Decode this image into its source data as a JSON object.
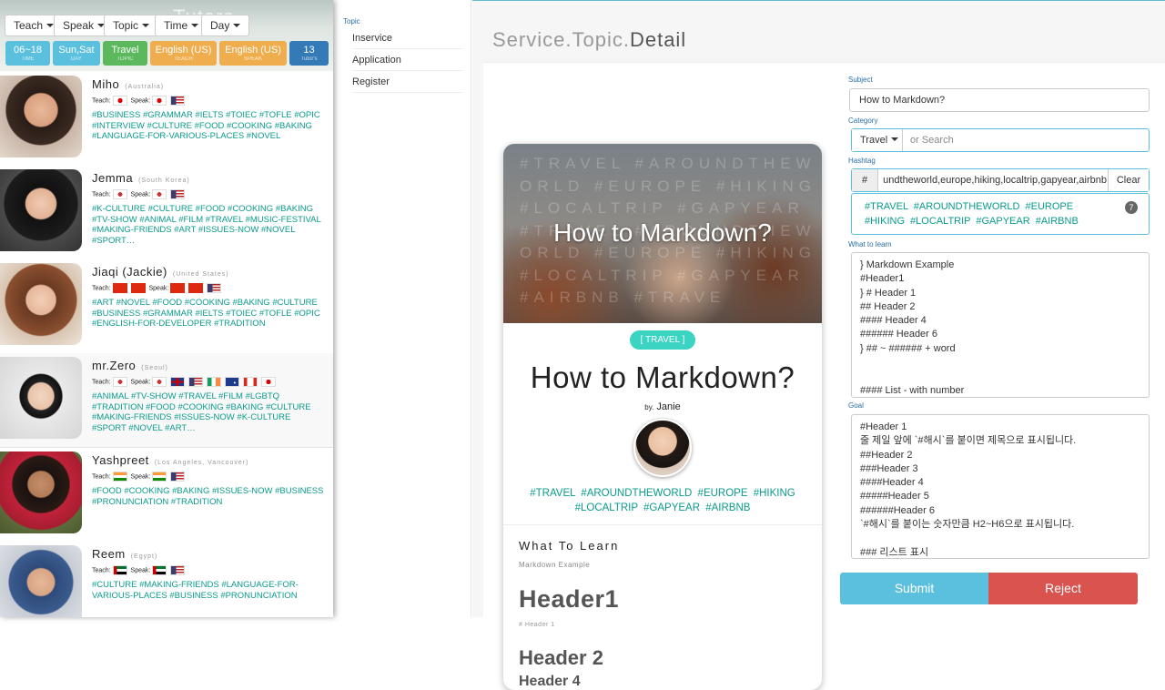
{
  "left": {
    "bg_title": "Tutors",
    "filters": [
      "Teach",
      "Speak",
      "Topic",
      "Time",
      "Day"
    ],
    "tags": [
      {
        "value": "06~18",
        "label": "TIME",
        "color": "#5bc0de"
      },
      {
        "value": "Sun,Sat",
        "label": "DAY",
        "color": "#5bc0de"
      },
      {
        "value": "Travel",
        "label": "TOPIC",
        "color": "#5cb85c"
      },
      {
        "value": "English (US)",
        "label": "TEACH",
        "color": "#f0ad4e"
      },
      {
        "value": "English (US)",
        "label": "SPEAK",
        "color": "#f0ad4e"
      },
      {
        "value": "13",
        "label": "Tutor's",
        "color": "#337ab7"
      }
    ],
    "teach_label": "Teach:",
    "speak_label": "Speak:",
    "tutors": [
      {
        "name": "Miho",
        "location": "(Australia)",
        "tags": "#BUSINESS #GRAMMAR #IELTS #TOIEC #TOFLE #OPIC #INTERVIEW #CULTURE #FOOD #COOKING #BAKING #LANGUAGE-FOR-VARIOUS-PLACES #NOVEL"
      },
      {
        "name": "Jemma",
        "location": "(South Korea)",
        "tags": "#K-CULTURE #CULTURE #FOOD #COOKING #BAKING #TV-SHOW #ANIMAL #FILM #TRAVEL #MUSIC-FESTIVAL #MAKING-FRIENDS #ART #ISSUES-NOW #NOVEL #SPORT…"
      },
      {
        "name": "Jiaqi (Jackie)",
        "location": "(United States)",
        "tags": "#ART #NOVEL #FOOD #COOKING #BAKING #CULTURE #BUSINESS #GRAMMAR #IELTS #TOIEC #TOFLE #OPIC #ENGLISH-FOR-DEVELOPER #TRADITION"
      },
      {
        "name": "mr.Zero",
        "location": "(Seoul)",
        "tags": "#ANIMAL #TV-SHOW #TRAVEL #FILM #LGBTQ #TRADITION #FOOD #COOKING #BAKING #CULTURE #MAKING-FRIENDS #ISSUES-NOW #K-CULTURE #SPORT #NOVEL #ART…"
      },
      {
        "name": "Yashpreet",
        "location": "(Los Angeles, Vancouver)",
        "tags": "#FOOD #COOKING #BAKING #ISSUES-NOW #BUSINESS #PRONUNCIATION #TRADITION"
      },
      {
        "name": "Reem",
        "location": "(Egypt)",
        "tags": "#CULTURE #MAKING-FRIENDS #LANGUAGE-FOR-VARIOUS-PLACES #BUSINESS #PRONUNCIATION"
      }
    ]
  },
  "nav": {
    "heading": "Topic",
    "items": [
      "Inservice",
      "Application",
      "Register"
    ]
  },
  "main": {
    "title_a": "Service.Topic.",
    "title_b": "Detail",
    "card": {
      "hero_bg_text": "#TRAVEL #AROUNDTHEWORLD #EUROPE #HIKING #LOCALTRIP #GAPYEAR #TRAVEL #AROUNDTHEWORLD #EUROPE #HIKING #LOCALTRIP #GAPYEAR #AIRBNB #TRAVE",
      "hero_title": "How to Markdown?",
      "category": "[ TRAVEL ]",
      "title": "How to Markdown?",
      "by": "by.",
      "author": "Janie",
      "tags": "#TRAVEL #AROUNDTHEWORLD #EUROPE #HIKING #LOCALTRIP #GAPYEAR #AIRBNB",
      "section": "What To Learn",
      "section_sub": "Markdown Example",
      "h1": "Header1",
      "h1_sub": "# Header 1",
      "h2": "Header 2",
      "h3": "Header 4"
    },
    "form": {
      "subject_label": "Subject",
      "subject_value": "How to Markdown?",
      "category_label": "Category",
      "category_value": "Travel",
      "category_placeholder": "or Search",
      "hashtag_label": "Hashtag",
      "hashtag_prefix": "#",
      "hashtag_value": ",travel,aroundtheworld,europe,hiking,localtrip,gapyear,airbnb",
      "clear_label": "Clear",
      "hashtag_preview": "#TRAVEL #AROUNDTHEWORLD #EUROPE #HIKING #LOCALTRIP #GAPYEAR #AIRBNB",
      "hashtag_count": "7",
      "learn_label": "What to learn",
      "learn_value": "} Markdown Example\n#Header1\n} # Header 1\n## Header 2\n#### Header 4\n###### Header 6\n} ## ~ ###### + word\n\n\n#### List - with number",
      "goal_label": "Goal",
      "goal_value": "#Header 1\n줄 제일 앞에 `#해시`를 붙이면 제목으로 표시됩니다.\n##Header 2\n###Header 3\n####Header 4\n#####Header 5\n######Header 6\n`#해시`를 붙이는 숫자만큼 H2~H6으로 표시됩니다.\n\n### 리스트 표시",
      "submit_label": "Submit",
      "reject_label": "Reject"
    }
  }
}
